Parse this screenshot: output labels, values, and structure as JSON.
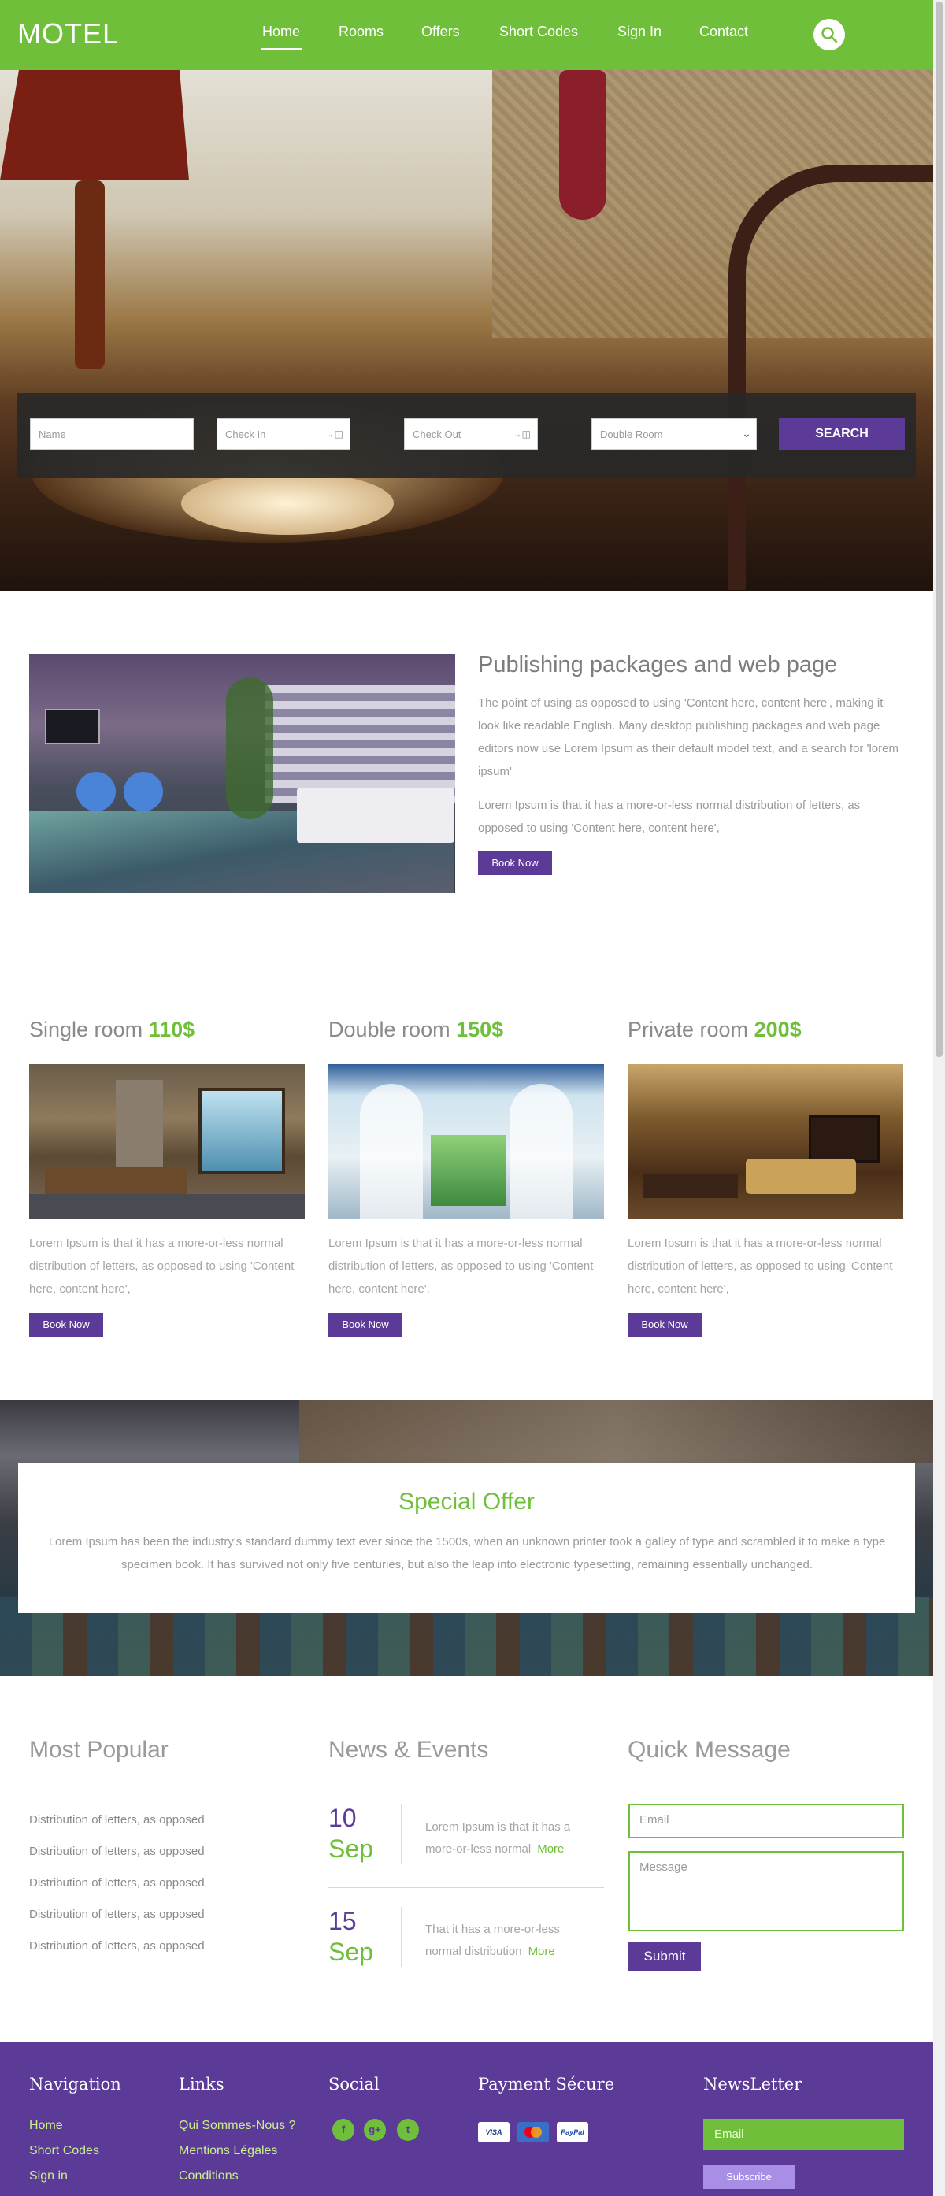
{
  "header": {
    "logo": "MOTEL",
    "nav": [
      {
        "label": "Home",
        "active": true
      },
      {
        "label": "Rooms"
      },
      {
        "label": "Offers"
      },
      {
        "label": "Short Codes"
      },
      {
        "label": "Sign In"
      },
      {
        "label": "Contact"
      }
    ],
    "search_icon": "search-icon"
  },
  "booking": {
    "name_placeholder": "Name",
    "checkin_placeholder": "Check In",
    "checkout_placeholder": "Check Out",
    "room_type": "Double Room",
    "search_label": "SEARCH"
  },
  "about": {
    "title": "Publishing packages and web page",
    "p1": "The point of using as opposed to using 'Content here, content here', making it look like readable English. Many desktop publishing packages and web page editors now use Lorem Ipsum as their default model text, and a search for 'lorem ipsum'",
    "p2": "Lorem Ipsum is that it has a more-or-less normal distribution of letters, as opposed to using 'Content here, content here',",
    "button": "Book Now"
  },
  "rooms": [
    {
      "name": "Single room",
      "price": "110$",
      "desc": "Lorem Ipsum is that it has a more-or-less normal distribution of letters, as opposed to using 'Content here, content here',",
      "button": "Book Now"
    },
    {
      "name": "Double room",
      "price": "150$",
      "desc": "Lorem Ipsum is that it has a more-or-less normal distribution of letters, as opposed to using 'Content here, content here',",
      "button": "Book Now"
    },
    {
      "name": "Private room",
      "price": "200$",
      "desc": "Lorem Ipsum is that it has a more-or-less normal distribution of letters, as opposed to using 'Content here, content here',",
      "button": "Book Now"
    }
  ],
  "offer": {
    "title": "Special Offer",
    "text": "Lorem Ipsum has been the industry's standard dummy text ever since the 1500s, when an unknown printer took a galley of type and scrambled it to make a type specimen book. It has survived not only five centuries, but also the leap into electronic typesetting, remaining essentially unchanged."
  },
  "popular": {
    "title": "Most Popular",
    "items": [
      "Distribution of letters, as opposed",
      "Distribution of letters, as opposed",
      "Distribution of letters, as opposed",
      "Distribution of letters, as opposed",
      "Distribution of letters, as opposed"
    ]
  },
  "news": {
    "title": "News & Events",
    "items": [
      {
        "day": "10",
        "month": "Sep",
        "text": "Lorem Ipsum is that it has a more-or-less normal",
        "more": "More"
      },
      {
        "day": "15",
        "month": "Sep",
        "text": "That it has a more-or-less normal distribution",
        "more": "More"
      }
    ]
  },
  "quick_message": {
    "title": "Quick Message",
    "email_placeholder": "Email",
    "message_placeholder": "Message",
    "submit": "Submit"
  },
  "footer": {
    "navigation": {
      "title": "Navigation",
      "links": [
        "Home",
        "Short Codes",
        "Sign in"
      ]
    },
    "links": {
      "title": "Links",
      "links": [
        "Qui Sommes-Nous ?",
        "Mentions Légales",
        "Conditions"
      ]
    },
    "social": {
      "title": "Social",
      "icons": [
        "facebook-icon",
        "google-plus-icon",
        "twitter-icon"
      ]
    },
    "payment": {
      "title": "Payment Sécure",
      "methods": [
        "VISA",
        "mastercard",
        "PayPal"
      ]
    },
    "newsletter": {
      "title": "NewsLetter",
      "email_placeholder": "Email",
      "button": "Subscribe"
    }
  },
  "colors": {
    "brand_green": "#6fbf3a",
    "brand_purple": "#5c3b98"
  }
}
